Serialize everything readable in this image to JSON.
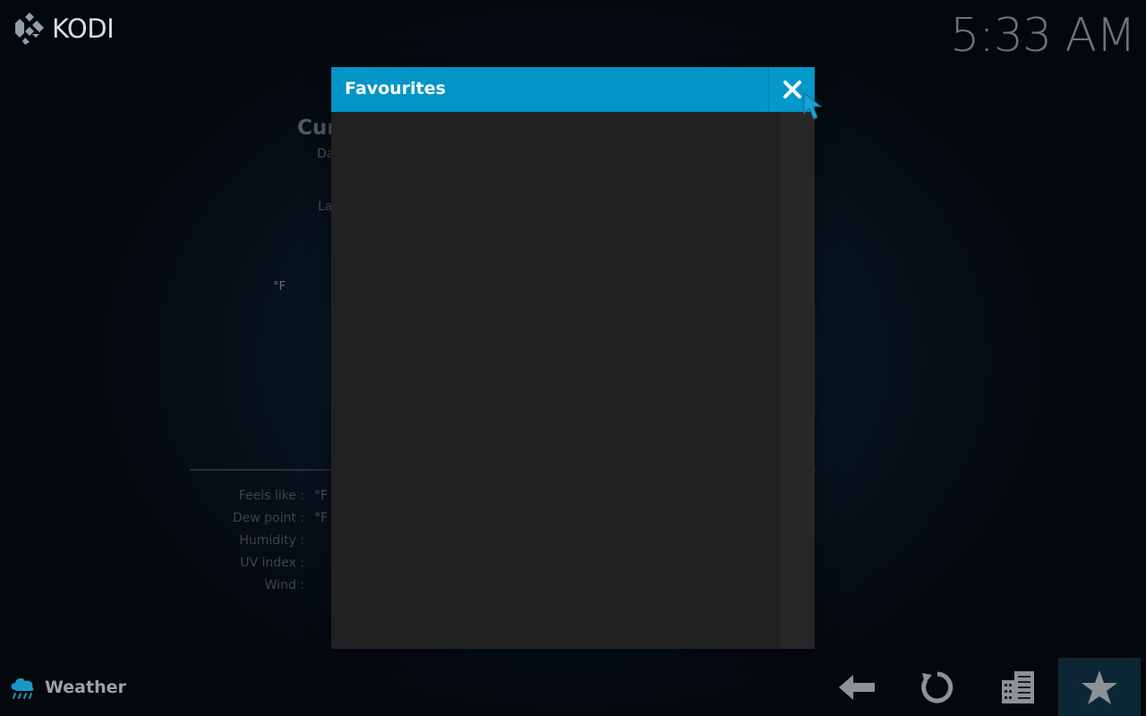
{
  "header": {
    "app_name": "KODI",
    "clock": "5:33 AM"
  },
  "weather_panel": {
    "title": "Cur",
    "line1": "Da",
    "line2": "La",
    "temp_unit": "°F",
    "details": [
      {
        "label": "Feels like :",
        "value": "°F"
      },
      {
        "label": "Dew point :",
        "value": "°F"
      },
      {
        "label": "Humidity :",
        "value": ""
      },
      {
        "label": "UV index :",
        "value": ""
      },
      {
        "label": "Wind :",
        "value": ""
      }
    ]
  },
  "dialog": {
    "title": "Favourites",
    "items": []
  },
  "footer": {
    "label": "Weather",
    "buttons": [
      {
        "name": "back",
        "icon": "back-arrow-icon"
      },
      {
        "name": "refresh",
        "icon": "refresh-icon"
      },
      {
        "name": "locations",
        "icon": "buildings-icon"
      },
      {
        "name": "favourites",
        "icon": "star-icon"
      }
    ]
  },
  "colors": {
    "accent": "#0295c6",
    "dialog_bg": "#212121",
    "background": "#081724"
  }
}
